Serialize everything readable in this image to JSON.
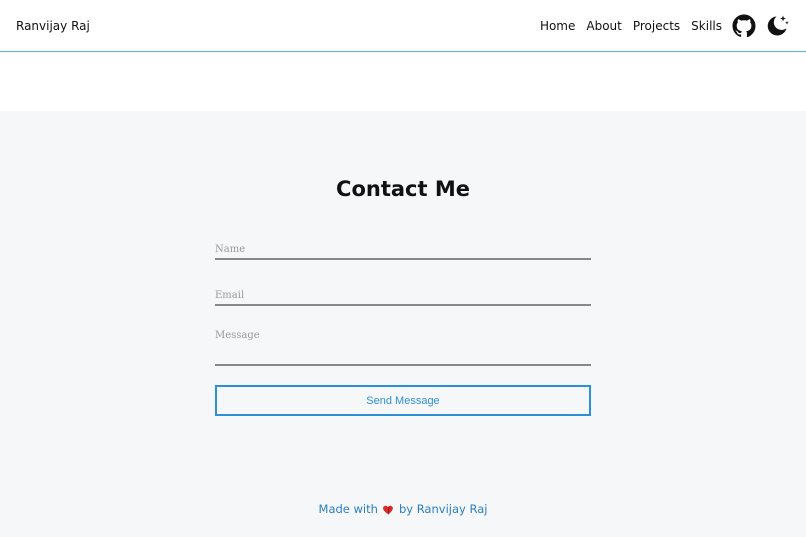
{
  "header": {
    "brand": "Ranvijay Raj",
    "nav": [
      "Home",
      "About",
      "Projects",
      "Skills"
    ],
    "icons": [
      "github-icon",
      "dark-mode-moon-icon"
    ]
  },
  "contact": {
    "title": "Contact Me",
    "name_placeholder": "Name",
    "email_placeholder": "Email",
    "message_placeholder": "Message",
    "send_label": "Send Message"
  },
  "footer": {
    "made_with": "Made with",
    "by": "by Ranvijay Raj"
  },
  "colors": {
    "accent": "#2d8fd5",
    "nav_border": "#5fb3d6",
    "heart": "#d92b2b"
  }
}
